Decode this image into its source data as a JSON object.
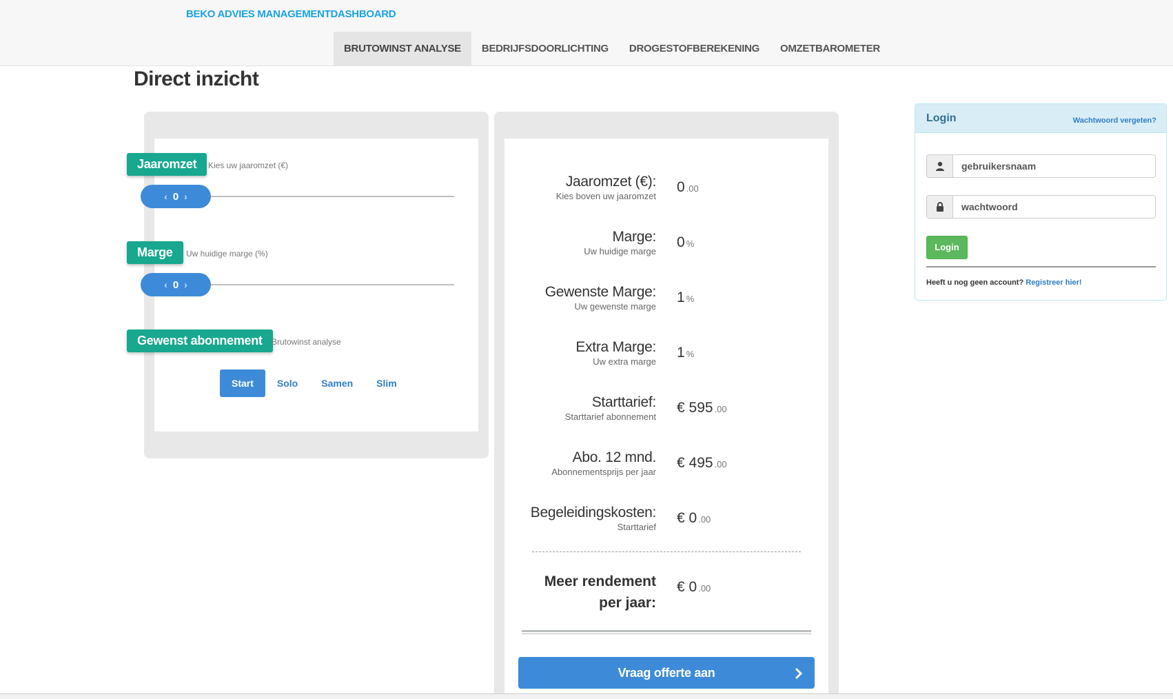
{
  "header": {
    "brand": "BEKO ADVIES MANAGEMENTDASHBOARD",
    "nav": [
      {
        "label": "BRUTOWINST ANALYSE",
        "active": true
      },
      {
        "label": "BEDRIJFSDOORLICHTING",
        "active": false
      },
      {
        "label": "DROGESTOFBEREKENING",
        "active": false
      },
      {
        "label": "OMZETBAROMETER",
        "active": false
      }
    ]
  },
  "page": {
    "title": "Direct inzicht"
  },
  "inputs": {
    "jaaromzet": {
      "tag": "Jaaromzet",
      "hint": "Kies uw jaaromzet (€)",
      "value": "0"
    },
    "marge": {
      "tag": "Marge",
      "hint": "Uw huidige marge (%)",
      "value": "0"
    },
    "abonnement": {
      "tag": "Gewenst abonnement",
      "hint": "Brutowinst analyse",
      "options": [
        {
          "label": "Start",
          "active": true
        },
        {
          "label": "Solo",
          "active": false
        },
        {
          "label": "Samen",
          "active": false
        },
        {
          "label": "Slim",
          "active": false
        }
      ]
    }
  },
  "results": [
    {
      "label": "Jaaromzet (€):",
      "sub": "Kies boven uw jaaromzet",
      "value": "0",
      "suffix": ".00"
    },
    {
      "label": "Marge:",
      "sub": "Uw huidige marge",
      "value": "0",
      "suffix": "%"
    },
    {
      "label": "Gewenste Marge:",
      "sub": "Uw gewenste marge",
      "value": "1",
      "suffix": "%"
    },
    {
      "label": "Extra Marge:",
      "sub": "Uw extra marge",
      "value": "1",
      "suffix": "%"
    },
    {
      "label": "Starttarief:",
      "sub": "Starttarief abonnement",
      "value": "€ 595",
      "suffix": ".00"
    },
    {
      "label": "Abo. 12 mnd.",
      "sub": "Abonnementsprijs per jaar",
      "value": "€ 495",
      "suffix": ".00"
    },
    {
      "label": "Begeleidingskosten:",
      "sub": "Starttarief",
      "value": "€ 0",
      "suffix": ".00"
    }
  ],
  "total": {
    "label_line1": "Meer rendement",
    "label_line2": "per jaar:",
    "value": "€ 0",
    "suffix": ".00"
  },
  "cta": {
    "label": "Vraag offerte aan",
    "icon": "chevron-right-icon"
  },
  "login": {
    "title": "Login",
    "forgot": "Wachtwoord vergeten?",
    "username_placeholder": "gebruikersnaam",
    "password_placeholder": "wachtwoord",
    "button": "Login",
    "register_text": "Heeft u nog geen account?",
    "register_link": "Registreer hier!"
  },
  "colors": {
    "accent": "#3d8bd8",
    "teal": "#17a88f",
    "brand": "#1aa3e0",
    "success": "#5cb85c"
  }
}
